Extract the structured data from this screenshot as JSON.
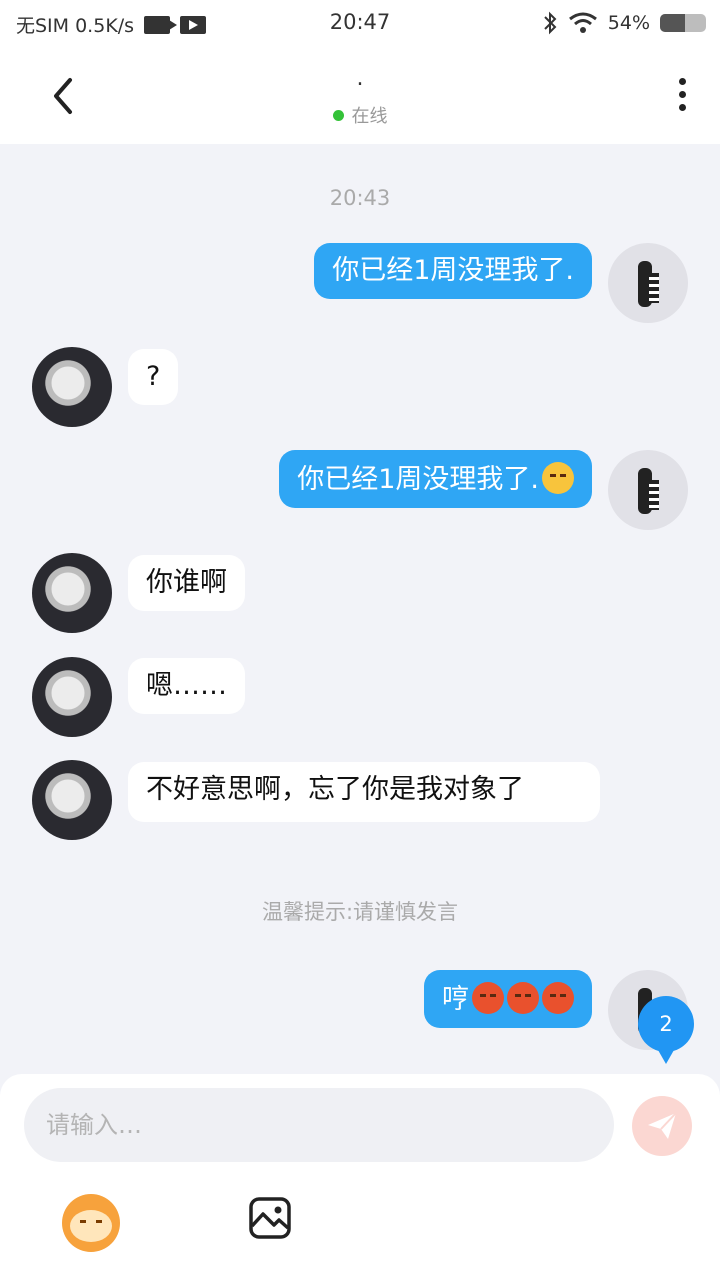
{
  "status_bar": {
    "left_text": "无SIM 0.5K/s",
    "time": "20:47",
    "battery_text": "54%",
    "battery_level_percent": 54,
    "icons": [
      "video-call-icon",
      "video-play-icon",
      "bluetooth-icon",
      "wifi-icon",
      "battery-icon"
    ]
  },
  "header": {
    "title": ".",
    "status": "在线",
    "status_color": "#34c238"
  },
  "chat": {
    "timestamp": "20:43",
    "tip": "温馨提示:请谨慎发言",
    "messages": [
      {
        "from": "me",
        "text": "你已经1周没理我了."
      },
      {
        "from": "other",
        "text": "?"
      },
      {
        "from": "me",
        "text": "你已经1周没理我了.",
        "emoji": [
          "unamused-face"
        ]
      },
      {
        "from": "other",
        "text": "你谁啊"
      },
      {
        "from": "other",
        "text": "嗯……"
      },
      {
        "from": "other",
        "text": "不好意思啊，忘了你是我对象了"
      },
      {
        "from": "me",
        "text": "哼",
        "emoji": [
          "angry-face",
          "angry-face",
          "angry-face"
        ]
      }
    ],
    "unread_badge": "2"
  },
  "input": {
    "placeholder": "请输入…",
    "value": ""
  },
  "colors": {
    "my_bubble": "#2fa6f4",
    "other_bubble": "#ffffff",
    "background": "#f2f3f8",
    "badge": "#2196f3",
    "send_button": "#fbd7d2"
  }
}
